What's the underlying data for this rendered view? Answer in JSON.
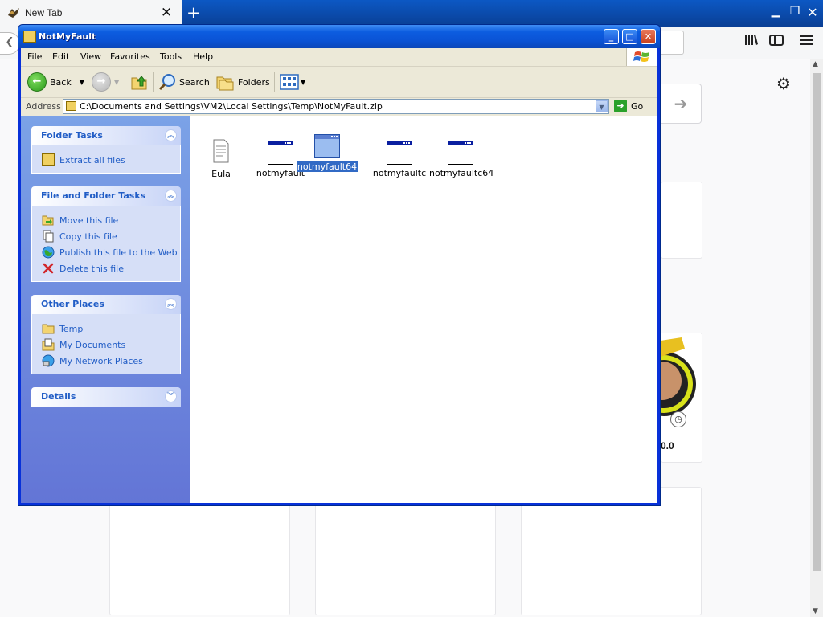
{
  "browser": {
    "tab_title": "New Tab",
    "tab_close": "✕",
    "new_tab": "+",
    "tile_label": "0.0"
  },
  "window": {
    "title": "NotMyFault",
    "buttons": {
      "minimize": "_",
      "maximize": "□",
      "close": "✕"
    }
  },
  "menu": [
    "File",
    "Edit",
    "View",
    "Favorites",
    "Tools",
    "Help"
  ],
  "toolbar": {
    "back": "Back",
    "search": "Search",
    "folders": "Folders"
  },
  "address": {
    "label": "Address",
    "path": "C:\\Documents and Settings\\VM2\\Local Settings\\Temp\\NotMyFault.zip",
    "go": "Go"
  },
  "sidebar": {
    "folder_tasks": {
      "title": "Folder Tasks",
      "items": [
        {
          "label": "Extract all files",
          "icon": "extract-icon"
        }
      ]
    },
    "file_folder_tasks": {
      "title": "File and Folder Tasks",
      "items": [
        {
          "label": "Move this file",
          "icon": "move-icon"
        },
        {
          "label": "Copy this file",
          "icon": "copy-icon"
        },
        {
          "label": "Publish this file to the Web",
          "icon": "globe-icon"
        },
        {
          "label": "Delete this file",
          "icon": "delete-icon"
        }
      ]
    },
    "other_places": {
      "title": "Other Places",
      "items": [
        {
          "label": "Temp",
          "icon": "folder-icon"
        },
        {
          "label": "My Documents",
          "icon": "documents-icon"
        },
        {
          "label": "My Network Places",
          "icon": "network-icon"
        }
      ]
    },
    "details": {
      "title": "Details"
    }
  },
  "files": [
    {
      "name": "Eula",
      "type": "text",
      "selected": false
    },
    {
      "name": "notmyfault",
      "type": "exe",
      "selected": false
    },
    {
      "name": "notmyfault64",
      "type": "exe",
      "selected": true
    },
    {
      "name": "notmyfaultc",
      "type": "exe",
      "selected": false
    },
    {
      "name": "notmyfaultc64",
      "type": "exe",
      "selected": false
    }
  ]
}
